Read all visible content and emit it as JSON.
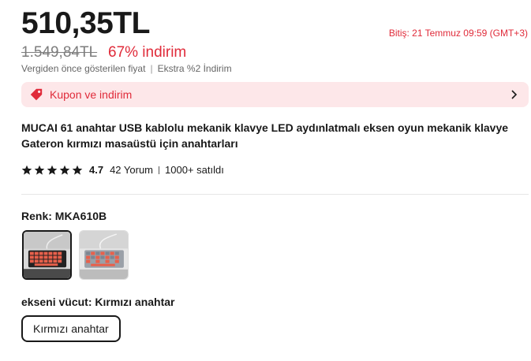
{
  "price": {
    "current": "510,35TL",
    "original": "1.549,84TL",
    "discount": "67% indirim",
    "ends": "Bitiş: 21 Temmuz 09:59 (GMT+3)",
    "note_prev": "Vergiden önce gösterilen fiyat",
    "note_extra": "Ekstra %2 İndirim"
  },
  "coupon": {
    "label": "Kupon ve indirim",
    "icon": "tag-icon",
    "accent": "#e02b3a",
    "bg": "#fde7e9"
  },
  "product": {
    "title": "MUCAI 61 anahtar USB kablolu mekanik klavye LED aydınlatmalı eksen oyun mekanik klavye Gateron kırmızı masaüstü için anahtarları"
  },
  "rating": {
    "score": "4.7",
    "stars": 5,
    "reviews": "42 Yorum",
    "sold": "1000+ satıldı"
  },
  "variants": {
    "color_label": "Renk: MKA610B",
    "axis_label": "ekseni vücut: Kırmızı anahtar",
    "axis_option": "Kırmızı anahtar"
  }
}
